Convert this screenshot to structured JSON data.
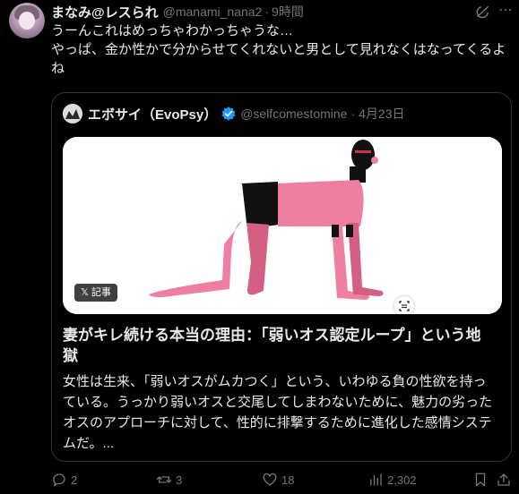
{
  "tweet": {
    "display_name": "まなみ@レスられ",
    "handle": "@manami_nana2",
    "separator": "·",
    "time": "9時間",
    "text_lines": [
      "うーんこれはめっちゃわかっちゃうな…",
      "やっぱ、金か性かで分からせてくれないと男として見れなくはなってくるよ",
      "ね"
    ],
    "avatar_icon": "user-avatar",
    "grok_icon": "grok-icon",
    "more_icon": "more-icon"
  },
  "quote": {
    "display_name": "エボサイ（EvoPsy）",
    "handle": "@selfcomestomine",
    "separator": "·",
    "date": "4月23日",
    "verified_color": "#1d9bf0",
    "article_badge": "𝕏 記事",
    "article_title_lines": [
      "妻がキレ続ける本当の理由：「弱いオス認定ループ」という地",
      "獄"
    ],
    "article_body_lines": [
      "女性は生来、「弱いオスがムカつく」という、いわゆる負の性欲を持っ",
      "ている。うっかり弱いオスと交尾してしまわないために、魅力の劣った",
      "オスのアプローチに対して、性的に排撃するために進化した感情システ",
      "ムだ。..."
    ],
    "illustration_colors": {
      "body": "#ef7fa0",
      "shadow": "#d45f82",
      "black": "#111111",
      "background": "#ffffff"
    }
  },
  "actions": {
    "reply_count": "2",
    "retweet_count": "3",
    "like_count": "18",
    "view_count": "2,302"
  },
  "colors": {
    "background": "#000000",
    "text_primary": "#e7e9ea",
    "text_secondary": "#71767b",
    "border": "#2f3336"
  }
}
